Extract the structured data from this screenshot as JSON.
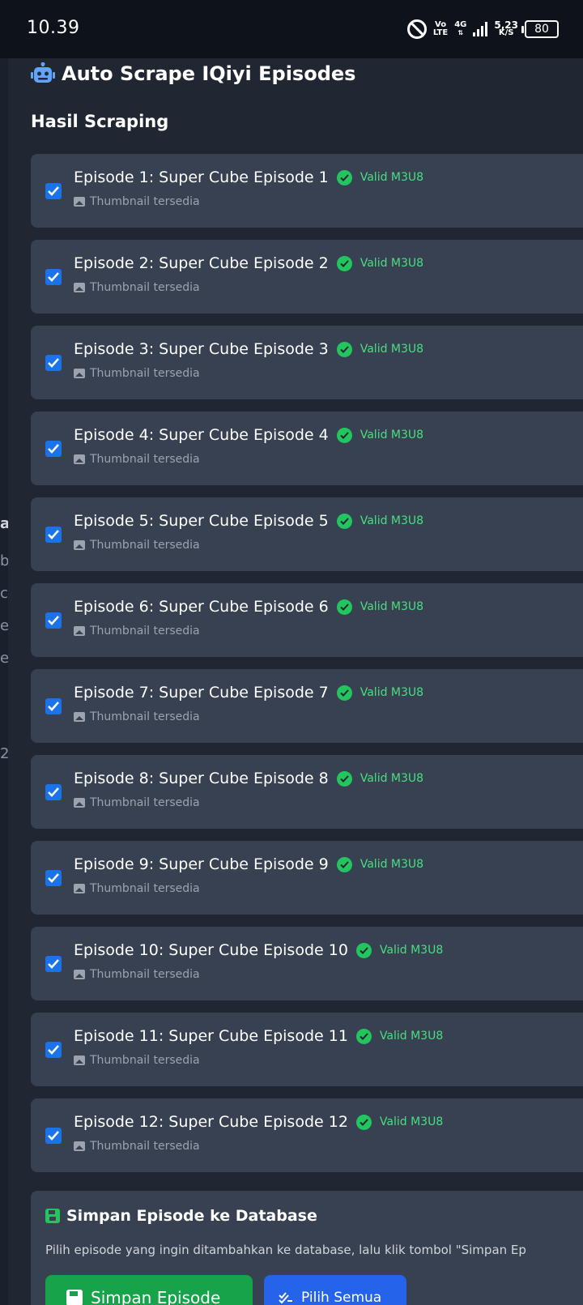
{
  "status_bar": {
    "time": "10.39",
    "volte_top": "Vo",
    "volte_bottom": "LTE",
    "network": "4G",
    "speed_value": "5,23",
    "speed_unit": "K/S",
    "battery": "80"
  },
  "modal": {
    "title": "Auto Scrape IQiyi Episodes",
    "section_title": "Hasil Scraping",
    "episodes": [
      {
        "title": "Episode 1: Super Cube Episode 1",
        "status": "Valid M3U8",
        "thumb": "Thumbnail tersedia",
        "checked": true
      },
      {
        "title": "Episode 2: Super Cube Episode 2",
        "status": "Valid M3U8",
        "thumb": "Thumbnail tersedia",
        "checked": true
      },
      {
        "title": "Episode 3: Super Cube Episode 3",
        "status": "Valid M3U8",
        "thumb": "Thumbnail tersedia",
        "checked": true
      },
      {
        "title": "Episode 4: Super Cube Episode 4",
        "status": "Valid M3U8",
        "thumb": "Thumbnail tersedia",
        "checked": true
      },
      {
        "title": "Episode 5: Super Cube Episode 5",
        "status": "Valid M3U8",
        "thumb": "Thumbnail tersedia",
        "checked": true
      },
      {
        "title": "Episode 6: Super Cube Episode 6",
        "status": "Valid M3U8",
        "thumb": "Thumbnail tersedia",
        "checked": true
      },
      {
        "title": "Episode 7: Super Cube Episode 7",
        "status": "Valid M3U8",
        "thumb": "Thumbnail tersedia",
        "checked": true
      },
      {
        "title": "Episode 8: Super Cube Episode 8",
        "status": "Valid M3U8",
        "thumb": "Thumbnail tersedia",
        "checked": true
      },
      {
        "title": "Episode 9: Super Cube Episode 9",
        "status": "Valid M3U8",
        "thumb": "Thumbnail tersedia",
        "checked": true
      },
      {
        "title": "Episode 10: Super Cube Episode 10",
        "status": "Valid M3U8",
        "thumb": "Thumbnail tersedia",
        "checked": true
      },
      {
        "title": "Episode 11: Super Cube Episode 11",
        "status": "Valid M3U8",
        "thumb": "Thumbnail tersedia",
        "checked": true
      },
      {
        "title": "Episode 12: Super Cube Episode 12",
        "status": "Valid M3U8",
        "thumb": "Thumbnail tersedia",
        "checked": true
      }
    ],
    "save_panel": {
      "title": "Simpan Episode ke Database",
      "description": "Pilih episode yang ingin ditambahkan ke database, lalu klik tombol \"Simpan Ep",
      "save_button": "Simpan Episode",
      "select_all_button": "Pilih Semua"
    }
  },
  "background": {
    "peek_chars": [
      "ar",
      "b",
      "c",
      "e",
      "e",
      "2"
    ]
  },
  "colors": {
    "accent_blue": "#1a73e8",
    "valid_green": "#22c55e",
    "card_bg": "#374151",
    "modal_bg": "#202733"
  }
}
